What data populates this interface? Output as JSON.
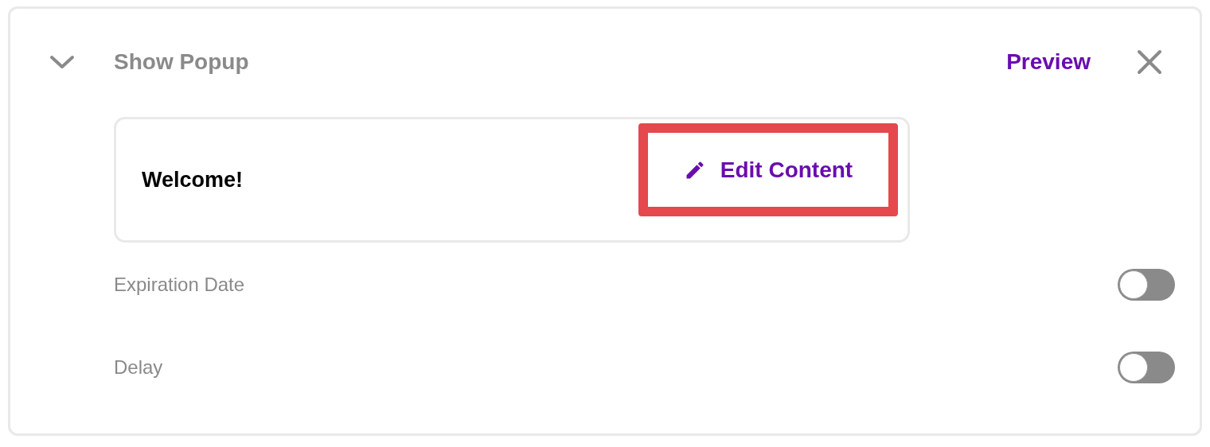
{
  "header": {
    "title": "Show Popup",
    "expanded": true,
    "preview_link": "Preview"
  },
  "content_card": {
    "title": "Welcome!",
    "edit_button": {
      "label": "Edit Content",
      "highlighted": true
    }
  },
  "settings": [
    {
      "label": "Expiration Date",
      "on": false
    },
    {
      "label": "Delay",
      "on": false
    }
  ]
}
